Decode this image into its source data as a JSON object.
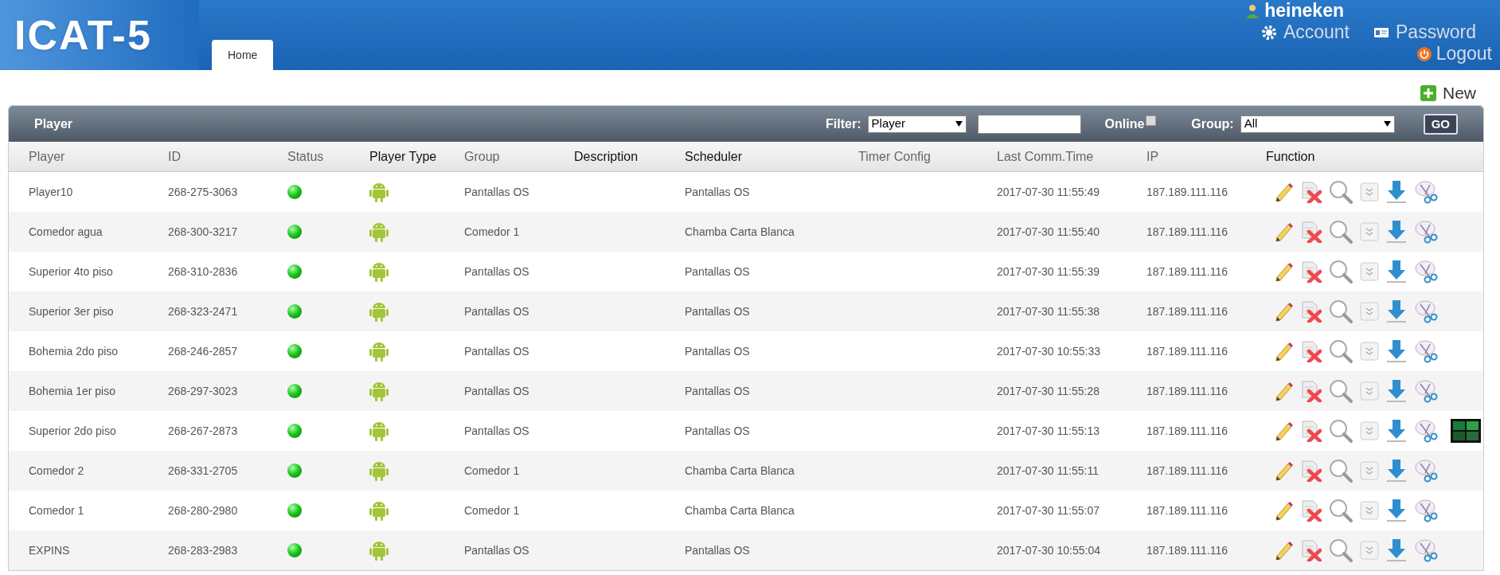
{
  "header": {
    "logo": "ICAT-5",
    "tabs": [
      {
        "label": "Home",
        "selected": true
      }
    ],
    "user": "heineken",
    "links": [
      {
        "kind": "account",
        "label": "Account"
      },
      {
        "kind": "password",
        "label": "Password"
      }
    ],
    "logout": "Logout"
  },
  "new_button": "New",
  "toolbar": {
    "title": "Player",
    "filter_label": "Filter:",
    "filter_value": "Player",
    "online_label": "Online",
    "online_checked": false,
    "group_label": "Group:",
    "group_value": "All",
    "go": "GO"
  },
  "table": {
    "columns": [
      {
        "label": "Player",
        "sortable": true
      },
      {
        "label": "ID",
        "sortable": true
      },
      {
        "label": "Status",
        "sortable": true
      },
      {
        "label": "Player Type",
        "sortable": false
      },
      {
        "label": "Group",
        "sortable": true
      },
      {
        "label": "Description",
        "sortable": false
      },
      {
        "label": "Scheduler",
        "sortable": false
      },
      {
        "label": "Timer Config",
        "sortable": true
      },
      {
        "label": "Last Comm.Time",
        "sortable": true
      },
      {
        "label": "IP",
        "sortable": true
      },
      {
        "label": "Function",
        "sortable": false
      }
    ],
    "rows": [
      {
        "player": "Player10",
        "id": "268-275-3063",
        "online": true,
        "group": "Pantallas OS",
        "scheduler": "Pantallas OS",
        "last_comm": "2017-07-30 11:55:49",
        "ip": "187.189.111.116",
        "thumbnail": false
      },
      {
        "player": "Comedor agua",
        "id": "268-300-3217",
        "online": true,
        "group": "Comedor 1",
        "scheduler": "Chamba Carta Blanca",
        "last_comm": "2017-07-30 11:55:40",
        "ip": "187.189.111.116",
        "thumbnail": false
      },
      {
        "player": "Superior 4to piso",
        "id": "268-310-2836",
        "online": true,
        "group": "Pantallas OS",
        "scheduler": "Pantallas OS",
        "last_comm": "2017-07-30 11:55:39",
        "ip": "187.189.111.116",
        "thumbnail": false
      },
      {
        "player": "Superior 3er piso",
        "id": "268-323-2471",
        "online": true,
        "group": "Pantallas OS",
        "scheduler": "Pantallas OS",
        "last_comm": "2017-07-30 11:55:38",
        "ip": "187.189.111.116",
        "thumbnail": false
      },
      {
        "player": "Bohemia 2do piso",
        "id": "268-246-2857",
        "online": true,
        "group": "Pantallas OS",
        "scheduler": "Pantallas OS",
        "last_comm": "2017-07-30 10:55:33",
        "ip": "187.189.111.116",
        "thumbnail": false
      },
      {
        "player": "Bohemia 1er piso",
        "id": "268-297-3023",
        "online": true,
        "group": "Pantallas OS",
        "scheduler": "Pantallas OS",
        "last_comm": "2017-07-30 11:55:28",
        "ip": "187.189.111.116",
        "thumbnail": false
      },
      {
        "player": "Superior 2do piso",
        "id": "268-267-2873",
        "online": true,
        "group": "Pantallas OS",
        "scheduler": "Pantallas OS",
        "last_comm": "2017-07-30 11:55:13",
        "ip": "187.189.111.116",
        "thumbnail": true
      },
      {
        "player": "Comedor 2",
        "id": "268-331-2705",
        "online": true,
        "group": "Comedor 1",
        "scheduler": "Chamba Carta Blanca",
        "last_comm": "2017-07-30 11:55:11",
        "ip": "187.189.111.116",
        "thumbnail": false
      },
      {
        "player": "Comedor 1",
        "id": "268-280-2980",
        "online": true,
        "group": "Comedor 1",
        "scheduler": "Chamba Carta Blanca",
        "last_comm": "2017-07-30 11:55:07",
        "ip": "187.189.111.116",
        "thumbnail": false
      },
      {
        "player": "EXPINS",
        "id": "268-283-2983",
        "online": true,
        "group": "Pantallas OS",
        "scheduler": "Pantallas OS",
        "last_comm": "2017-07-30 10:55:04",
        "ip": "187.189.111.116",
        "thumbnail": false
      }
    ]
  }
}
